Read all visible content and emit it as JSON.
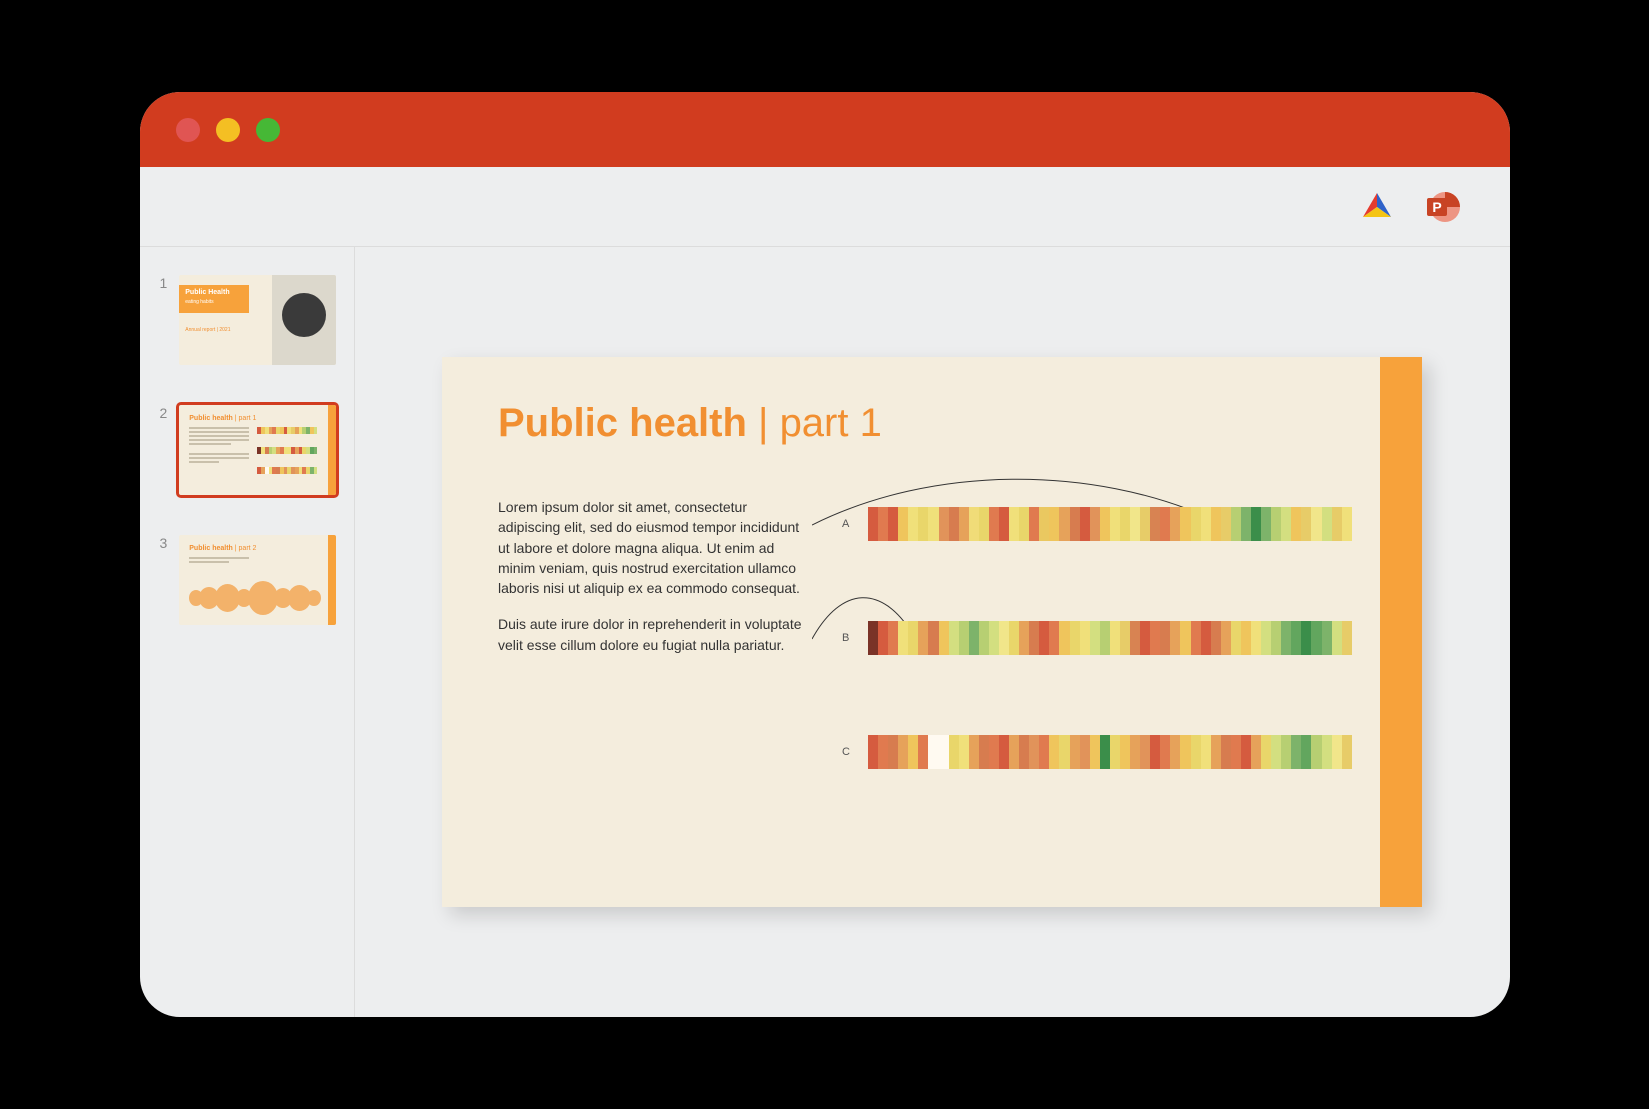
{
  "colors": {
    "accent": "#f18f31",
    "accent_bar": "#f7a23b",
    "titlebar": "#d13c1f"
  },
  "thumbnails": [
    {
      "number": "1",
      "title": "Public Health",
      "subtitle": "eating habits",
      "footer": "Annual report | 2021"
    },
    {
      "number": "2",
      "title_bold": "Public health",
      "title_rest": " | part 1"
    },
    {
      "number": "3",
      "title_bold": "Public health",
      "title_rest": " | part 2"
    }
  ],
  "slide": {
    "title_bold": "Public health",
    "title_sep": " | ",
    "title_rest": "part 1",
    "paragraph1": "Lorem ipsum dolor sit amet, consectetur adipiscing elit, sed do eiusmod tempor incididunt ut labore et dolore magna aliqua. Ut enim ad minim veniam, quis nostrud exercitation ullamco laboris nisi ut aliquip ex ea commodo consequat.",
    "paragraph2": "Duis aute irure dolor in reprehenderit in voluptate velit esse cillum dolore eu fugiat nulla pariatur.",
    "heatmaps": {
      "a_label": "A",
      "b_label": "B",
      "c_label": "C"
    }
  },
  "chart_data": [
    {
      "type": "heatmap",
      "title": "A",
      "categories": [],
      "values": [
        "#d55b3f",
        "#e07a4f",
        "#d55b3f",
        "#efc55c",
        "#f0e07a",
        "#e9d66a",
        "#f0e07a",
        "#e1935a",
        "#d77c4f",
        "#e6a25a",
        "#f0dc78",
        "#e9d66a",
        "#e07a4f",
        "#d55b3f",
        "#f0e07a",
        "#e9d66a",
        "#e07a4f",
        "#eac860",
        "#efc55c",
        "#e6a25a",
        "#d77c4f",
        "#d55b3f",
        "#e1935a",
        "#efc55c",
        "#f0e07a",
        "#e9d66a",
        "#f1e68a",
        "#e7cc68",
        "#d88352",
        "#e07a4f",
        "#e6a25a",
        "#efc55c",
        "#e9d66a",
        "#f0e07a",
        "#efc55c",
        "#e7cc68",
        "#b7cf72",
        "#7db36a",
        "#3b8e4a",
        "#7db36a",
        "#b7cf72",
        "#d3df80",
        "#efc55c",
        "#e7cc68",
        "#f1e68a",
        "#d3df80",
        "#e7cc68",
        "#f0e07a"
      ]
    },
    {
      "type": "heatmap",
      "title": "B",
      "categories": [],
      "values": [
        "#7a3327",
        "#d55b3f",
        "#e07a4f",
        "#f0e07a",
        "#e9d66a",
        "#e6a25a",
        "#d77c4f",
        "#efc55c",
        "#d3df80",
        "#b7cf72",
        "#7db36a",
        "#b7cf72",
        "#d3df80",
        "#f1e68a",
        "#e9d66a",
        "#e6a25a",
        "#d77c4f",
        "#d55b3f",
        "#e07a4f",
        "#efc55c",
        "#e9d66a",
        "#f0e07a",
        "#d3df80",
        "#b7cf72",
        "#f0e07a",
        "#e7cc68",
        "#d88352",
        "#d55b3f",
        "#e07a4f",
        "#d77c4f",
        "#e6a25a",
        "#efc55c",
        "#e07a4f",
        "#d55b3f",
        "#d77c4f",
        "#e6a25a",
        "#e9d66a",
        "#efc55c",
        "#f0e07a",
        "#d3df80",
        "#b7cf72",
        "#7db36a",
        "#62a65e",
        "#3b8e4a",
        "#62a65e",
        "#7db36a",
        "#d3df80",
        "#e7cc68"
      ]
    },
    {
      "type": "heatmap",
      "title": "C",
      "categories": [],
      "values": [
        "#d55b3f",
        "#e07a4f",
        "#d77c4f",
        "#e6a25a",
        "#efc55c",
        "#e07a4f",
        "#fffaf1",
        "#fffaf1",
        "#e9d66a",
        "#f0e07a",
        "#e6a25a",
        "#d77c4f",
        "#e07a4f",
        "#d55b3f",
        "#e6a25a",
        "#d77c4f",
        "#e1935a",
        "#e07a4f",
        "#efc55c",
        "#e9d66a",
        "#e6a25a",
        "#e1935a",
        "#efc55c",
        "#3b8e4a",
        "#e9d66a",
        "#efc55c",
        "#e6a25a",
        "#e1935a",
        "#d55b3f",
        "#e07a4f",
        "#e6a25a",
        "#efc55c",
        "#e9d66a",
        "#f0e07a",
        "#e6a25a",
        "#d77c4f",
        "#e07a4f",
        "#d55b3f",
        "#e6a25a",
        "#e9d66a",
        "#d3df80",
        "#b7cf72",
        "#7db36a",
        "#62a65e",
        "#b7cf72",
        "#d3df80",
        "#f1e68a",
        "#e7cc68"
      ]
    }
  ]
}
